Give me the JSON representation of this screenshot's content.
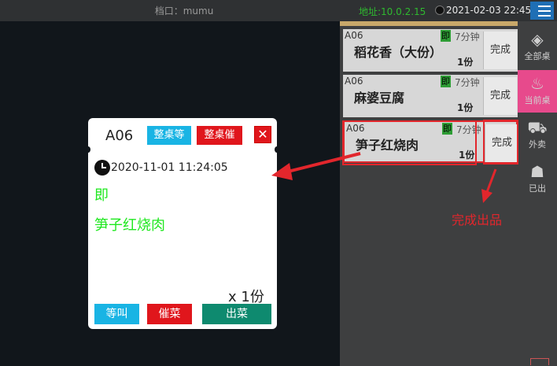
{
  "header": {
    "title": "档口：mumu",
    "address": "地址:10.0.2.15",
    "datetime": "2021-02-03 22:45"
  },
  "orders": [
    {
      "table": "A06",
      "tag": "即",
      "time": "7分钟",
      "dish": "稻花香（大份）",
      "qty": "1份",
      "done_label": "完成"
    },
    {
      "table": "A06",
      "tag": "即",
      "time": "7分钟",
      "dish": "麻婆豆腐",
      "qty": "1份",
      "done_label": "完成"
    },
    {
      "table": "A06",
      "tag": "即",
      "time": "7分钟",
      "dish": "笋子红烧肉",
      "qty": "1份",
      "done_label": "完成"
    }
  ],
  "sidebar": {
    "items": [
      {
        "label": "全部桌",
        "icon": "layers-icon"
      },
      {
        "label": "当前桌",
        "icon": "pot-icon"
      },
      {
        "label": "外卖",
        "icon": "scooter-icon"
      },
      {
        "label": "已出",
        "icon": "person-served-icon"
      }
    ]
  },
  "popup": {
    "table": "A06",
    "btn_wait_all": "整桌等",
    "btn_rush_all": "整桌催",
    "close": "✕",
    "time": "2020-11-01 11:24:05",
    "flag": "即",
    "dish": "笋子红烧肉",
    "qty": "x 1份",
    "btn_call": "等叫",
    "btn_urge": "催菜",
    "btn_serve": "出菜"
  },
  "annotation": "完成出品",
  "colors": {
    "accent_red": "#e2262c",
    "green_text": "#1fe81f",
    "blue_button": "#19b4e4",
    "teal_button": "#0e8a6f",
    "active_tab": "#e74a8c"
  }
}
